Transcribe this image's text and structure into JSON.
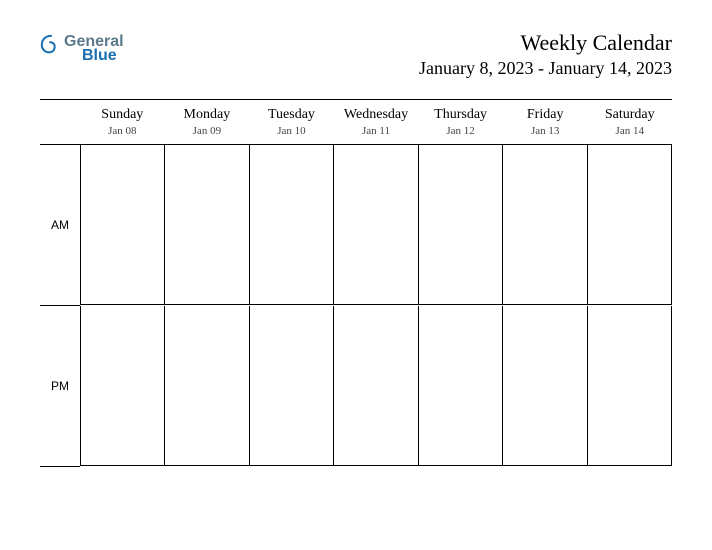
{
  "brand": {
    "word1": "General",
    "word2": "Blue"
  },
  "title": "Weekly Calendar",
  "date_range": "January 8, 2023 - January 14, 2023",
  "time_labels": {
    "am": "AM",
    "pm": "PM"
  },
  "days": [
    {
      "name": "Sunday",
      "date": "Jan 08"
    },
    {
      "name": "Monday",
      "date": "Jan 09"
    },
    {
      "name": "Tuesday",
      "date": "Jan 10"
    },
    {
      "name": "Wednesday",
      "date": "Jan 11"
    },
    {
      "name": "Thursday",
      "date": "Jan 12"
    },
    {
      "name": "Friday",
      "date": "Jan 13"
    },
    {
      "name": "Saturday",
      "date": "Jan 14"
    }
  ]
}
